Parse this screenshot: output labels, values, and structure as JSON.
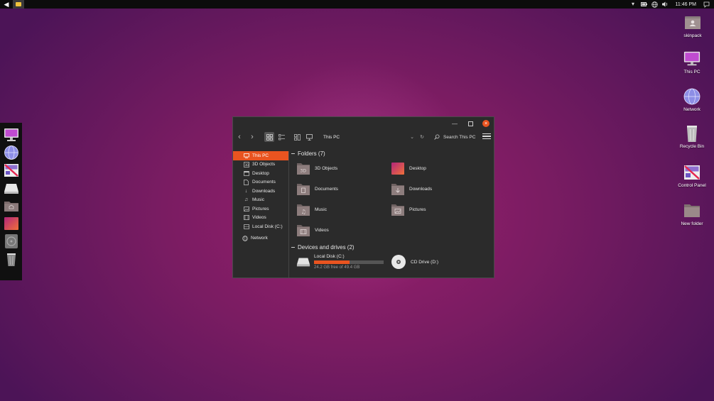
{
  "topbar": {
    "clock": "11:46 PM",
    "icons": [
      "back-icon",
      "file-explorer-icon",
      "chevron-down-icon",
      "battery-icon",
      "network-icon",
      "volume-icon",
      "notification-icon"
    ]
  },
  "dock": {
    "items": [
      "this-pc-icon",
      "network-globe-icon",
      "control-panel-icon",
      "disk-drive-icon",
      "home-folder-icon",
      "desktop-folder-icon",
      "cd-drive-icon",
      "recycle-bin-icon"
    ]
  },
  "desktop_icons": [
    {
      "label": "skinpack"
    },
    {
      "label": "This PC"
    },
    {
      "label": "Network"
    },
    {
      "label": "Recycle Bin"
    },
    {
      "label": "Control Panel"
    },
    {
      "label": "New folder"
    }
  ],
  "explorer": {
    "address": "This PC",
    "search_placeholder": "Search This PC",
    "nav": [
      {
        "label": "This PC"
      },
      {
        "label": "3D Objects"
      },
      {
        "label": "Desktop"
      },
      {
        "label": "Documents"
      },
      {
        "label": "Downloads"
      },
      {
        "label": "Music"
      },
      {
        "label": "Pictures"
      },
      {
        "label": "Videos"
      },
      {
        "label": "Local Disk (C:)"
      },
      {
        "label": "Network"
      }
    ],
    "folders_header": "Folders (7)",
    "folders": [
      {
        "label": "3D Objects"
      },
      {
        "label": "Desktop"
      },
      {
        "label": "Documents"
      },
      {
        "label": "Downloads"
      },
      {
        "label": "Music"
      },
      {
        "label": "Pictures"
      },
      {
        "label": "Videos"
      }
    ],
    "devices_header": "Devices and drives (2)",
    "drives": [
      {
        "label": "Local Disk (C:)",
        "space": "24.2 GB free of 49.4 GB",
        "used_fraction": 0.51
      },
      {
        "label": "CD Drive (D:)"
      }
    ]
  },
  "colors": {
    "accent": "#e95420",
    "window_bg": "#2b2b2b"
  }
}
